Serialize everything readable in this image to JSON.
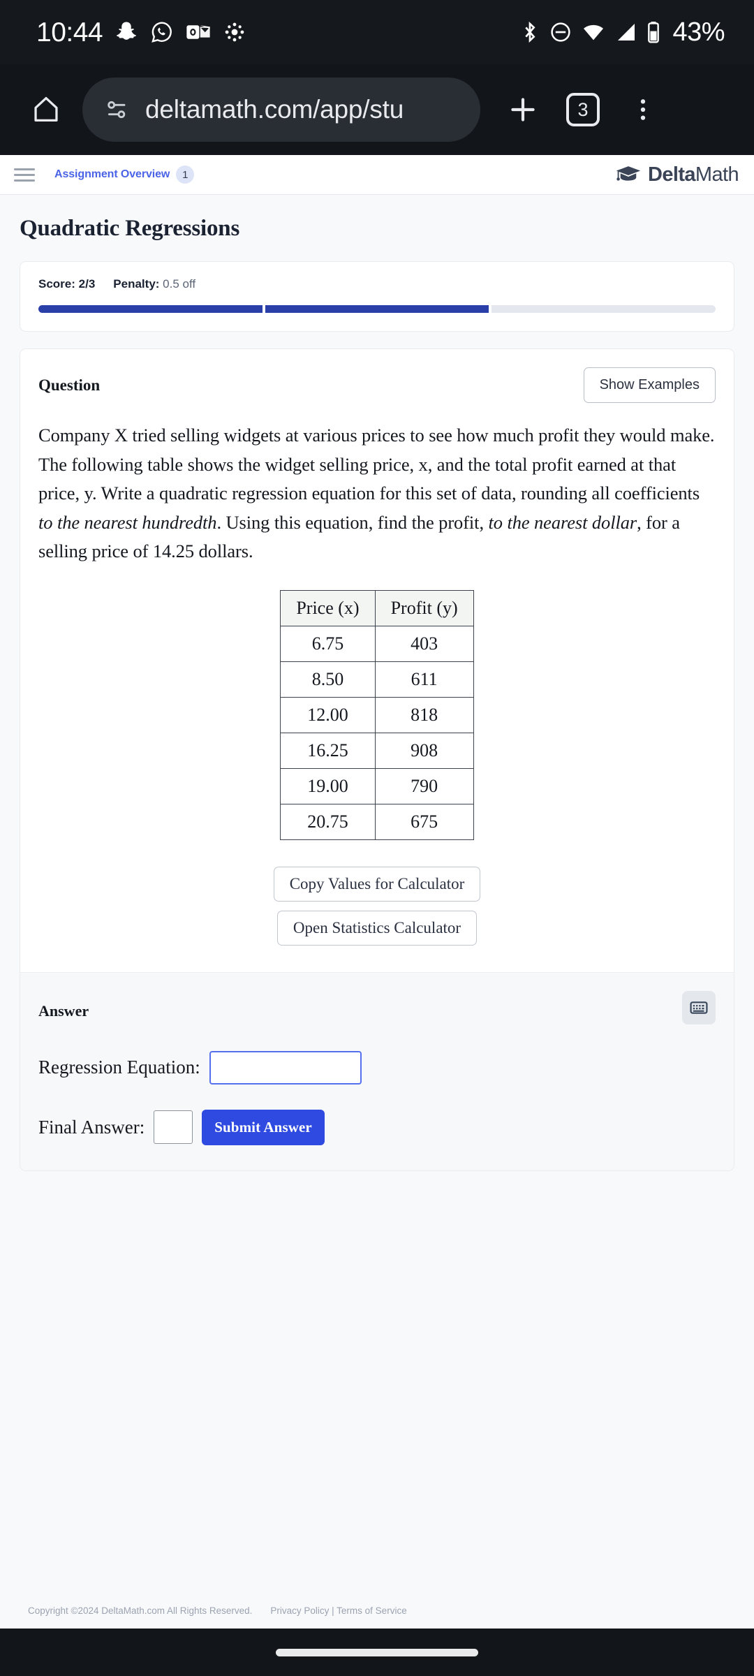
{
  "status_bar": {
    "clock": "10:44",
    "battery_percent": "43%",
    "left_icons": [
      "snapchat-icon",
      "whatsapp-icon",
      "outlook-icon",
      "canvas-icon"
    ],
    "right_icons": [
      "bluetooth-icon",
      "do-not-disturb-icon",
      "wifi-icon",
      "cellular-signal-icon",
      "battery-icon"
    ]
  },
  "browser": {
    "url": "deltamath.com/app/stu",
    "tab_count": "3",
    "home_icon": "home-icon",
    "site_info_icon": "site-settings-icon",
    "new_tab_icon": "plus-icon",
    "menu_icon": "kebab-menu-icon"
  },
  "site_nav": {
    "menu_icon": "hamburger-menu-icon",
    "overview_link": "Assignment Overview",
    "overview_badge": "1",
    "brand_bold": "Delta",
    "brand_light": "Math",
    "brand_icon": "graduation-cap-icon",
    "link_color": "#4a63e7"
  },
  "page": {
    "title": "Quadratic Regressions"
  },
  "score": {
    "score_label": "Score:",
    "score_value": "2/3",
    "penalty_label": "Penalty:",
    "penalty_value": "0.5 off",
    "segments": [
      true,
      true,
      false
    ],
    "fill_color": "#2a3fa8",
    "empty_color": "#e4e7ee"
  },
  "question": {
    "label": "Question",
    "show_examples_label": "Show Examples",
    "text_part1": "Company X tried selling widgets at various prices to see how much profit they would make. The following table shows the widget selling price, x, and the total profit earned at that price, y. Write a quadratic regression equation for this set of data, rounding all coefficients ",
    "emphasis1": "to the nearest hundredth",
    "text_part2": ". Using this equation, find the profit, ",
    "emphasis2": "to the nearest dollar",
    "text_part3": ", for a selling price of 14.25 dollars."
  },
  "data_table": {
    "headers": [
      "Price (x)",
      "Profit (y)"
    ],
    "rows": [
      [
        "6.75",
        "403"
      ],
      [
        "8.50",
        "611"
      ],
      [
        "12.00",
        "818"
      ],
      [
        "16.25",
        "908"
      ],
      [
        "19.00",
        "790"
      ],
      [
        "20.75",
        "675"
      ]
    ]
  },
  "calculator_buttons": {
    "copy_values": "Copy Values for Calculator",
    "open_stats": "Open Statistics Calculator"
  },
  "answer": {
    "label": "Answer",
    "keyboard_icon": "keyboard-icon",
    "regression_label": "Regression Equation:",
    "regression_value": "",
    "final_label": "Final Answer:",
    "final_value": "",
    "submit_label": "Submit Answer",
    "submit_color": "#2f4ae0",
    "focus_border_color": "#5470ef"
  },
  "footer": {
    "copyright": "Copyright ©2024 DeltaMath.com All Rights Reserved.",
    "privacy": "Privacy Policy",
    "separator": "|",
    "terms": "Terms of Service"
  }
}
